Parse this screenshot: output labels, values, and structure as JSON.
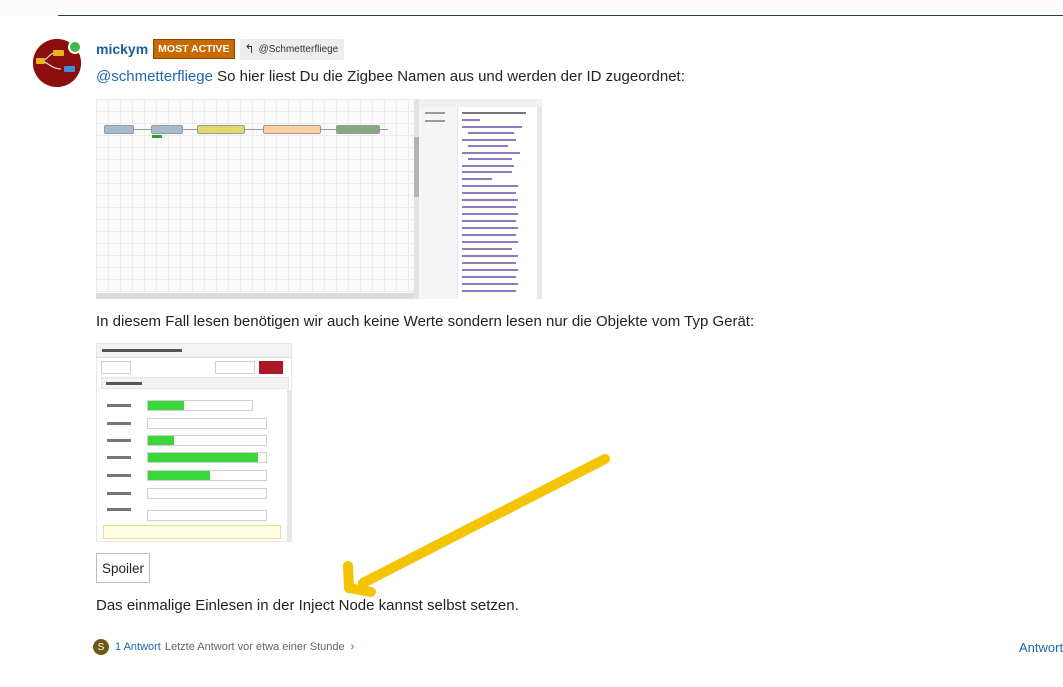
{
  "post": {
    "author": "mickym",
    "badge": "MOST ACTIVE",
    "reply_to": "@Schmetterfliege",
    "mention": "@schmetterfliege",
    "text_1": " So hier liest Du die Zigbee Namen aus und werden der ID zugeordnet:",
    "text_2": "In diesem Fall lesen benötigen wir auch keine Werte sondern lesen nur die Objekte vom Typ Gerät:",
    "spoiler_label": "Spoiler",
    "text_3": "Das einmalige Einlesen in der Inject Node kannst selbst setzen."
  },
  "footer": {
    "avatar_letter": "S",
    "reply_count": "1 Antwort",
    "last_reply": "Letzte Antwort vor etwa einer Stunde",
    "chevron": "›",
    "reply_action": "Antwort"
  },
  "icons": {
    "reply": "reply-arrow-icon",
    "online": "online-status-dot",
    "arrow": "yellow-annotation-arrow"
  },
  "colors": {
    "badge": "#c86a00",
    "link": "#1f66b0",
    "username": "#1f5d96",
    "arrow": "#f4c400"
  }
}
